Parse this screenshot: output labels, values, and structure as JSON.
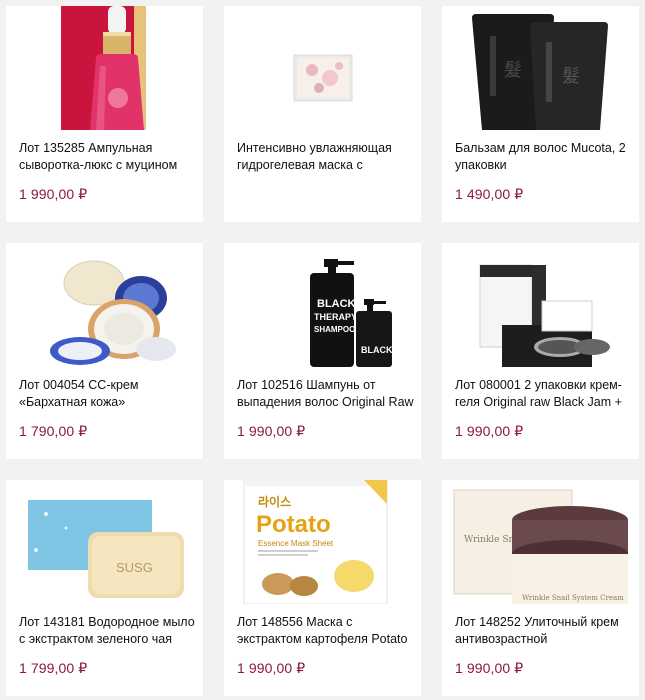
{
  "products": [
    {
      "title": "Лот 135285 Ампульная сыворотка-люкс с муцином",
      "price": "1 990,00 ₽",
      "image": "ampoule-serum-bottle"
    },
    {
      "title": "Интенсивно увлажняющая гидрогелевая маска с",
      "price": "",
      "image": "hydrogel-mask-pack"
    },
    {
      "title": "Бальзам для волос Mucota, 2 упаковки",
      "price": "1 490,00 ₽",
      "image": "black-hair-balm-tubes"
    },
    {
      "title": "Лот 004054 CC-крем «Бархатная кожа»",
      "price": "1 790,00 ₽",
      "image": "cushion-compact"
    },
    {
      "title": "Лот 102516 Шампунь от выпадения волос Original Raw",
      "price": "1 990,00 ₽",
      "image": "black-shampoo-bottles"
    },
    {
      "title": "Лот 080001 2 упаковки крем-геля Original raw Black Jam +",
      "price": "1 990,00 ₽",
      "image": "cream-gel-jars-boxes"
    },
    {
      "title": "Лот 143181 Водородное мыло с экстрактом зеленого чая",
      "price": "1 799,00 ₽",
      "image": "soap-bar-box"
    },
    {
      "title": "Лот 148556 Маска с экстрактом картофеля Potato",
      "price": "1 990,00 ₽",
      "image": "potato-sheet-mask"
    },
    {
      "title": "Лот 148252 Улиточный крем антивозрастной",
      "price": "1 990,00 ₽",
      "image": "snail-cream-jar"
    }
  ],
  "image_text": {
    "potato_brand": "라이스",
    "potato_name": "Potato",
    "potato_sub": "Essence Mask Sheet",
    "snail_label": "Wrinkle Snail",
    "snail_sub": "Wrinkle Snail System Cream",
    "soap_brand": "SUSG",
    "shampoo_l1": "BLACK",
    "shampoo_l2": "THERAPY",
    "shampoo_l3": "SHAMPOO",
    "shampoo_small": "BLACK"
  },
  "colors": {
    "price": "#8b1a3a",
    "background": "#f2f2f2",
    "card": "#ffffff"
  }
}
